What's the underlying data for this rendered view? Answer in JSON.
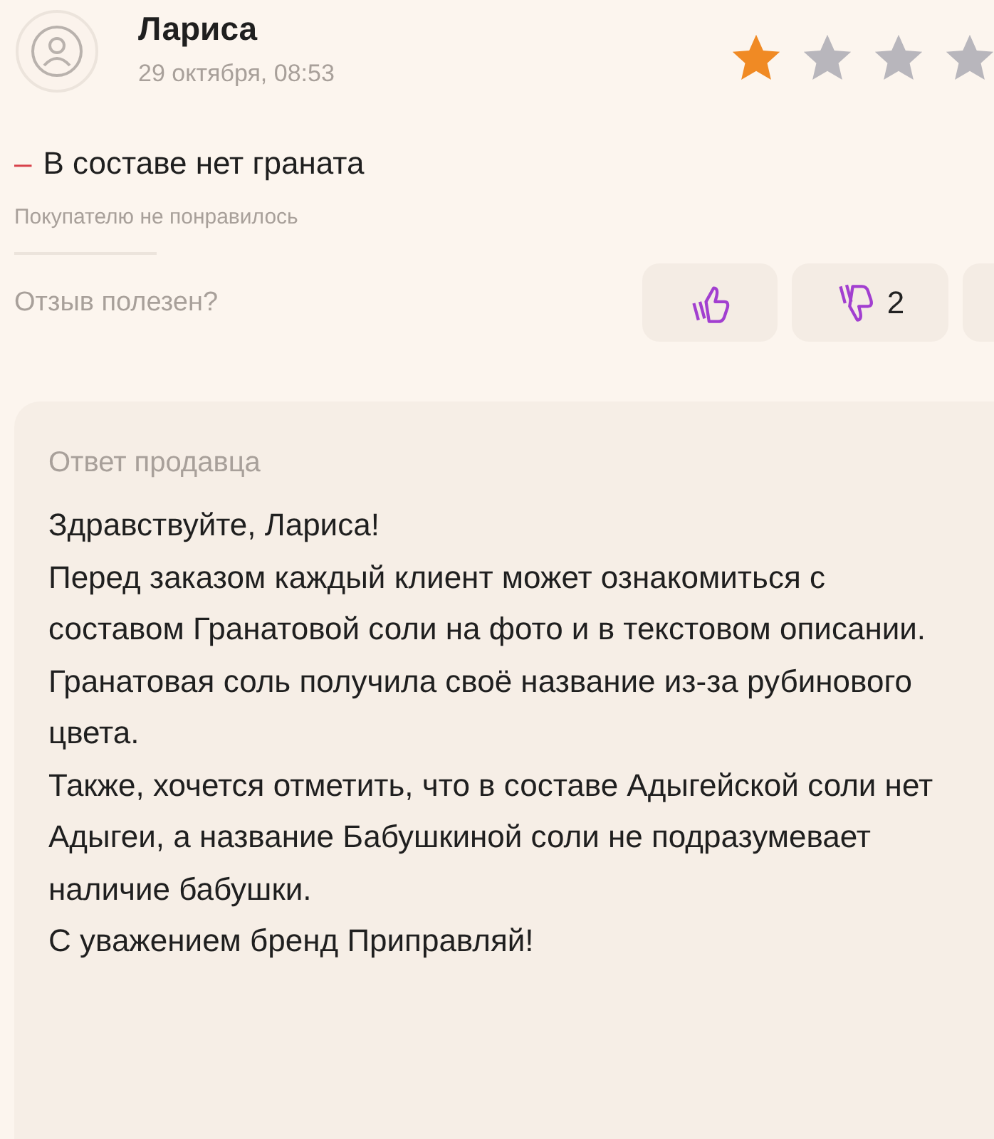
{
  "review": {
    "author": "Лариса",
    "date": "29 октября, 08:53",
    "stars": 1,
    "cons": {
      "marker": "–",
      "text": "В составе нет граната"
    },
    "verdict": "Покупателю не понравилось",
    "helpful": {
      "question": "Отзыв полезен?",
      "dislikes": "2"
    }
  },
  "seller_reply": {
    "title": "Ответ продавца",
    "paragraphs": [
      "Здравствуйте, Лариса!",
      "Перед заказом каждый клиент может ознакомиться с составом Гранатовой соли на фото и в текстовом описании.",
      "Гранатовая соль получила своё название из-за рубинового цвета.",
      "Также, хочется отметить, что в составе Адыгейской соли нет Адыгеи, а название Бабушкиной соли не подразумевает наличие бабушки.",
      "С уважением бренд Приправляй!"
    ]
  }
}
